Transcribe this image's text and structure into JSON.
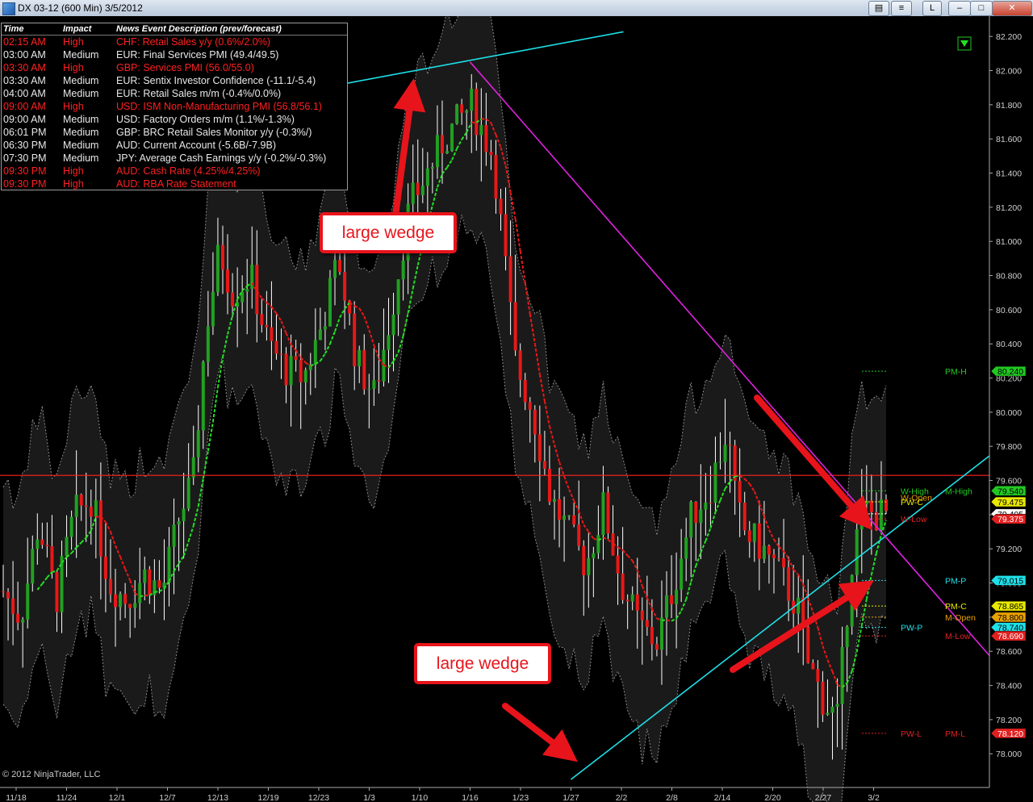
{
  "window": {
    "title": "DX 03-12 (600 Min)  3/5/2012",
    "toolbar": {
      "print_icon": "print-icon",
      "list_icon": "list-icon",
      "link_label": "L"
    }
  },
  "news": {
    "headers": [
      "Time",
      "Impact",
      "News Event Description (prev/forecast)"
    ],
    "rows": [
      {
        "time": "02:15 AM",
        "impact": "High",
        "desc": "CHF: Retail Sales y/y (0.6%/2.0%)"
      },
      {
        "time": "03:00 AM",
        "impact": "Medium",
        "desc": "EUR: Final Services PMI (49.4/49.5)"
      },
      {
        "time": "03:30 AM",
        "impact": "High",
        "desc": "GBP: Services PMI (56.0/55.0)"
      },
      {
        "time": "03:30 AM",
        "impact": "Medium",
        "desc": "EUR: Sentix Investor Confidence (-11.1/-5.4)"
      },
      {
        "time": "04:00 AM",
        "impact": "Medium",
        "desc": "EUR: Retail Sales m/m (-0.4%/0.0%)"
      },
      {
        "time": "09:00 AM",
        "impact": "High",
        "desc": "USD: ISM Non-Manufacturing PMI (56.8/56.1)"
      },
      {
        "time": "09:00 AM",
        "impact": "Medium",
        "desc": "USD: Factory Orders m/m (1.1%/-1.3%)"
      },
      {
        "time": "06:01 PM",
        "impact": "Medium",
        "desc": "GBP: BRC Retail Sales Monitor y/y (-0.3%/)"
      },
      {
        "time": "06:30 PM",
        "impact": "Medium",
        "desc": "AUD: Current Account (-5.6B/-7.9B)"
      },
      {
        "time": "07:30 PM",
        "impact": "Medium",
        "desc": "JPY: Average Cash Earnings y/y (-0.2%/-0.3%)"
      },
      {
        "time": "09:30 PM",
        "impact": "High",
        "desc": "AUD: Cash Rate (4.25%/4.25%)"
      },
      {
        "time": "09:30 PM",
        "impact": "High",
        "desc": "AUD: RBA Rate Statement"
      }
    ],
    "colors": {
      "High": "#ff2020",
      "Medium": "#e8e8e8"
    }
  },
  "annotations": {
    "upper_label": "large wedge",
    "lower_label": "large wedge"
  },
  "copyright": "© 2012 NinjaTrader, LLC",
  "chart_data": {
    "type": "candlestick",
    "symbol": "DX 03-12",
    "interval": "600 Min",
    "ylim": [
      77.85,
      82.3
    ],
    "x_ticks": [
      "11/18",
      "11/24",
      "12/1",
      "12/7",
      "12/13",
      "12/19",
      "12/23",
      "1/3",
      "1/10",
      "1/16",
      "1/23",
      "1/27",
      "2/2",
      "2/8",
      "2/14",
      "2/20",
      "2/27",
      "3/2"
    ],
    "y_ticks": [
      82.2,
      82.0,
      81.8,
      81.6,
      81.4,
      81.2,
      81.0,
      80.8,
      80.6,
      80.4,
      80.2,
      80.0,
      79.8,
      79.6,
      79.4,
      79.2,
      79.0,
      78.8,
      78.6,
      78.4,
      78.2,
      78.0
    ],
    "price_path": [
      [
        0,
        78.95
      ],
      [
        0.02,
        78.8
      ],
      [
        0.04,
        79.35
      ],
      [
        0.06,
        78.9
      ],
      [
        0.08,
        79.4
      ],
      [
        0.1,
        79.5
      ],
      [
        0.12,
        79.0
      ],
      [
        0.14,
        78.9
      ],
      [
        0.16,
        79.05
      ],
      [
        0.18,
        78.95
      ],
      [
        0.2,
        79.4
      ],
      [
        0.215,
        79.6
      ],
      [
        0.23,
        80.5
      ],
      [
        0.245,
        80.95
      ],
      [
        0.26,
        80.7
      ],
      [
        0.28,
        80.8
      ],
      [
        0.3,
        80.4
      ],
      [
        0.32,
        80.25
      ],
      [
        0.34,
        80.2
      ],
      [
        0.36,
        80.5
      ],
      [
        0.38,
        80.9
      ],
      [
        0.4,
        80.3
      ],
      [
        0.42,
        80.1
      ],
      [
        0.44,
        80.6
      ],
      [
        0.46,
        81.2
      ],
      [
        0.48,
        81.4
      ],
      [
        0.5,
        81.6
      ],
      [
        0.53,
        81.8
      ],
      [
        0.555,
        81.5
      ],
      [
        0.57,
        80.8
      ],
      [
        0.58,
        80.3
      ],
      [
        0.6,
        80.0
      ],
      [
        0.62,
        79.5
      ],
      [
        0.64,
        79.3
      ],
      [
        0.66,
        79.1
      ],
      [
        0.68,
        79.45
      ],
      [
        0.7,
        79.0
      ],
      [
        0.72,
        78.75
      ],
      [
        0.74,
        78.65
      ],
      [
        0.76,
        79.0
      ],
      [
        0.78,
        79.4
      ],
      [
        0.8,
        79.55
      ],
      [
        0.82,
        79.9
      ],
      [
        0.83,
        79.45
      ],
      [
        0.84,
        79.3
      ],
      [
        0.86,
        79.2
      ],
      [
        0.88,
        79.05
      ],
      [
        0.9,
        78.85
      ],
      [
        0.91,
        78.55
      ],
      [
        0.93,
        78.3
      ],
      [
        0.945,
        78.2
      ],
      [
        0.96,
        79.1
      ],
      [
        0.97,
        79.35
      ],
      [
        0.975,
        79.44
      ],
      [
        0.985,
        79.4
      ]
    ],
    "horizontal_lines": [
      {
        "name": "horizontal-line",
        "value": 79.63,
        "color": "#ff2020"
      }
    ],
    "trendlines": [
      {
        "name": "upper-cyan-trendline",
        "color": "#1ee0e8",
        "from": [
          "1/3",
          81.95
        ],
        "to": [
          "1/16",
          82.06
        ],
        "extend": "both"
      },
      {
        "name": "lower-cyan-trendline",
        "color": "#1ee0e8",
        "from": [
          "1/27",
          77.85
        ],
        "to": [
          "3/2",
          79.22
        ],
        "extend": "right"
      },
      {
        "name": "magenta-trendline",
        "color": "#e020e0",
        "from": [
          "1/16",
          82.05
        ],
        "to": [
          "3/2",
          79.35
        ],
        "extend": "right"
      }
    ],
    "price_levels": [
      {
        "value": 80.24,
        "label": "PM-H",
        "bg": "#22c822",
        "text": "#000"
      },
      {
        "value": 79.54,
        "label": "M-High",
        "bg": "#22c822",
        "text": "#000"
      },
      {
        "value": 79.475,
        "label": "PW-C",
        "bg": "#e8e800",
        "text": "#000"
      },
      {
        "value": 79.405,
        "label": "",
        "bg": "#ffffff",
        "text": "#000"
      },
      {
        "value": 79.375,
        "label": "W-Low",
        "bg": "#e02020",
        "text": "#fff"
      },
      {
        "value": 79.015,
        "label": "PM-P",
        "bg": "#1ee0e8",
        "text": "#000"
      },
      {
        "value": 78.865,
        "label": "PM-C",
        "bg": "#e8e800",
        "text": "#000"
      },
      {
        "value": 78.8,
        "label": "M-Open",
        "bg": "#e8a000",
        "text": "#000"
      },
      {
        "value": 78.74,
        "label": "PW-P",
        "bg": "#1ee0e8",
        "text": "#000"
      },
      {
        "value": 78.69,
        "label": "M-Low",
        "bg": "#e02020",
        "text": "#fff"
      },
      {
        "value": 78.12,
        "label": "PW-L",
        "bg": "#e02020",
        "text": "#fff"
      }
    ],
    "level_tags": [
      {
        "value": 80.24,
        "label": "PM-H",
        "color": "#22c822",
        "column": "right"
      },
      {
        "value": 79.54,
        "label": "M-High",
        "color": "#22c822",
        "column": "right"
      },
      {
        "value": 79.54,
        "label": "W-High",
        "color": "#22c822",
        "column": "left"
      },
      {
        "value": 79.5,
        "label": "W-Open",
        "color": "#e8a000",
        "column": "left"
      },
      {
        "value": 79.475,
        "label": "PW-C",
        "color": "#e8e800",
        "column": "left"
      },
      {
        "value": 79.375,
        "label": "W-Low",
        "color": "#e02020",
        "column": "left"
      },
      {
        "value": 79.015,
        "label": "PM-P",
        "color": "#1ee0e8",
        "column": "right"
      },
      {
        "value": 78.865,
        "label": "PM-C",
        "color": "#e8e800",
        "column": "right"
      },
      {
        "value": 78.8,
        "label": "M-Open",
        "color": "#e8a000",
        "column": "right"
      },
      {
        "value": 78.74,
        "label": "PW-P",
        "color": "#1ee0e8",
        "column": "left"
      },
      {
        "value": 78.69,
        "label": "M-Low",
        "color": "#e02020",
        "column": "right"
      },
      {
        "value": 78.12,
        "label": "PW-L",
        "color": "#e02020",
        "column": "left"
      },
      {
        "value": 78.12,
        "label": "PM-L",
        "color": "#e02020",
        "column": "right"
      }
    ],
    "colors": {
      "up": "#22a022",
      "down": "#e81818",
      "wick": "#ffffff",
      "grid": "#222222",
      "bg": "#000000",
      "envelope": "#8a8a8a",
      "ma_up": "#22e022",
      "ma_down": "#e81818"
    },
    "legend": "none",
    "grid": false
  }
}
